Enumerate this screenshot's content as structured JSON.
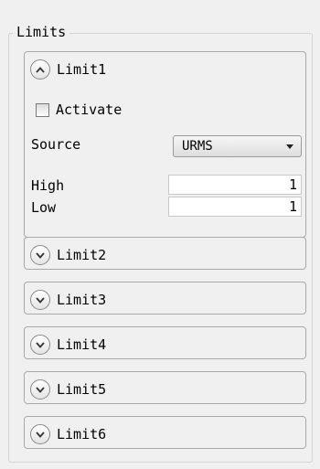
{
  "group": {
    "title": "Limits"
  },
  "limit1": {
    "label": "Limit1",
    "expanded": true,
    "activate": {
      "label": "Activate",
      "checked": false
    },
    "source": {
      "label": "Source",
      "value": "URMS"
    },
    "high": {
      "label": "High",
      "value": "1"
    },
    "low": {
      "label": "Low",
      "value": "1"
    }
  },
  "collapsed_sections": [
    {
      "label": "Limit2"
    },
    {
      "label": "Limit3"
    },
    {
      "label": "Limit4"
    },
    {
      "label": "Limit5"
    },
    {
      "label": "Limit6"
    }
  ],
  "icons": {
    "expand": "chevron-down-icon",
    "collapse": "chevron-up-icon",
    "dropdown": "triangle-down-icon"
  },
  "colors": {
    "panel_bg": "#f0f0f0",
    "border": "#a9a9a9",
    "input_bg": "#ffffff"
  }
}
